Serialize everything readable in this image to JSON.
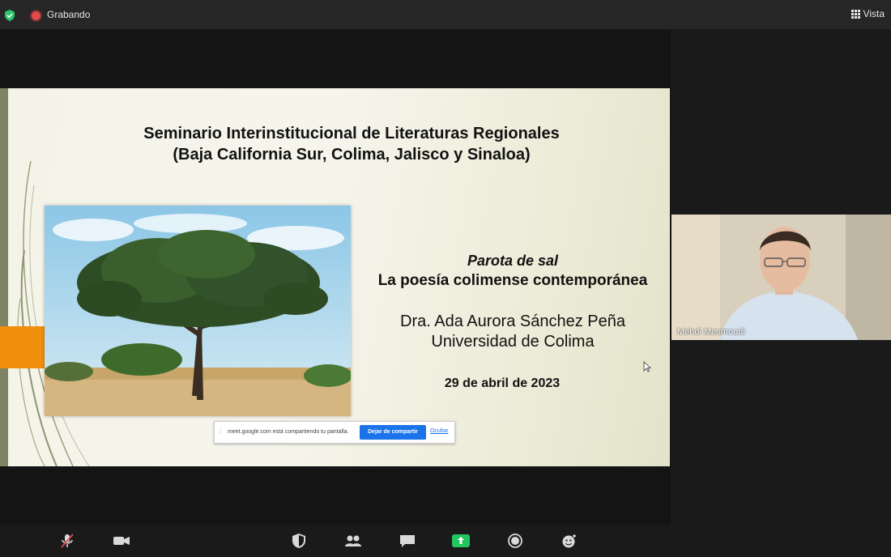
{
  "topbar": {
    "recording_label": "Grabando",
    "view_label": "Vista"
  },
  "slide": {
    "title_line1": "Seminario Interinstitucional de Literaturas Regionales",
    "title_line2": "(Baja California Sur, Colima, Jalisco y Sinaloa)",
    "italic_title": "Parota de sal",
    "subtitle": "La poesía colimense contemporánea",
    "author": "Dra. Ada Aurora Sánchez Peña",
    "institution": "Universidad de Colima",
    "date": "29 de abril de 2023"
  },
  "share_notification": {
    "message": "meet.google.com está compartiendo tu pantalla.",
    "stop_button": "Dejar de compartir",
    "hide_link": "Ocultar"
  },
  "participant": {
    "name": "Mehdi Mesmoudi"
  },
  "toolbar": {
    "icons": [
      "microphone-muted-icon",
      "video-camera-icon",
      "security-shield-icon",
      "participants-icon",
      "chat-icon",
      "share-screen-icon",
      "record-icon",
      "reactions-icon"
    ]
  },
  "colors": {
    "share_accent": "#23c55e",
    "recording": "#e24a4a",
    "slide_orange": "#f0900c",
    "button_blue": "#1a73e8"
  }
}
